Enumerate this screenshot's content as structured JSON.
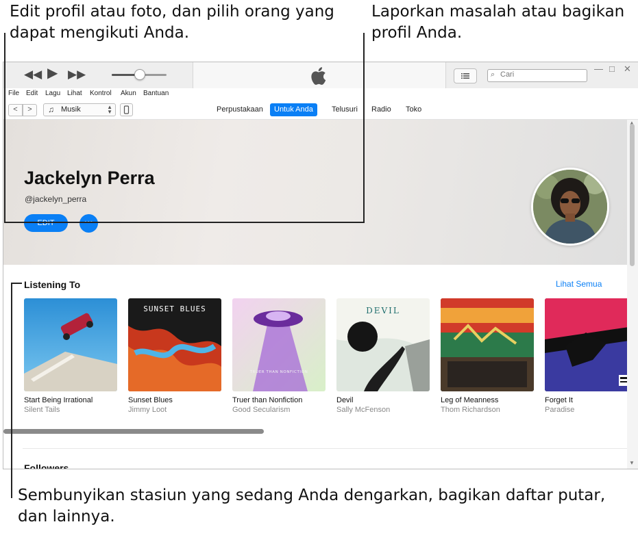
{
  "callouts": {
    "top_left": "Edit profil atau foto, dan pilih orang yang dapat mengikuti Anda.",
    "top_right": "Laporkan masalah atau bagikan profil Anda.",
    "bottom": "Sembunyikan stasiun yang sedang Anda dengarkan, bagikan daftar putar, dan lainnya."
  },
  "toolbar": {
    "rewind_icon": "rewind-icon",
    "play_icon": "play-icon",
    "forward_icon": "fast-forward-icon",
    "volume_level": 0.5,
    "search_placeholder": "Cari",
    "search_icon": "⌕",
    "window_controls": [
      "—",
      "□",
      "✕"
    ]
  },
  "menubar": [
    "File",
    "Edit",
    "Lagu",
    "Lihat",
    "Kontrol",
    "Akun",
    "Bantuan"
  ],
  "navbar": {
    "back": "<",
    "forward": ">",
    "media_type": "Musik",
    "tabs": [
      {
        "label": "Perpustakaan",
        "active": false
      },
      {
        "label": "Untuk Anda",
        "active": true
      },
      {
        "label": "Telusuri",
        "active": false
      },
      {
        "label": "Radio",
        "active": false
      },
      {
        "label": "Toko",
        "active": false
      }
    ]
  },
  "profile": {
    "name": "Jackelyn Perra",
    "handle": "@jackelyn_perra",
    "edit_label": "EDIT",
    "more_label": "···"
  },
  "listening": {
    "title": "Listening To",
    "see_all": "Lihat Semua",
    "albums": [
      {
        "title": "Start Being Irrational",
        "artist": "Silent Tails"
      },
      {
        "title": "Sunset Blues",
        "artist": "Jimmy Loot",
        "cover_text": "SUNSET BLUES"
      },
      {
        "title": "Truer than Nonfiction",
        "artist": "Good Secularism",
        "cover_text": "TRUER THAN NONFICTION"
      },
      {
        "title": "Devil",
        "artist": "Sally McFenson",
        "cover_text": "DEVIL"
      },
      {
        "title": "Leg of Meanness",
        "artist": "Thom Richardson"
      },
      {
        "title": "Forget It",
        "artist": "Paradise"
      }
    ]
  },
  "followers": {
    "title": "Followers"
  },
  "colors": {
    "accent": "#0a7ff5"
  }
}
